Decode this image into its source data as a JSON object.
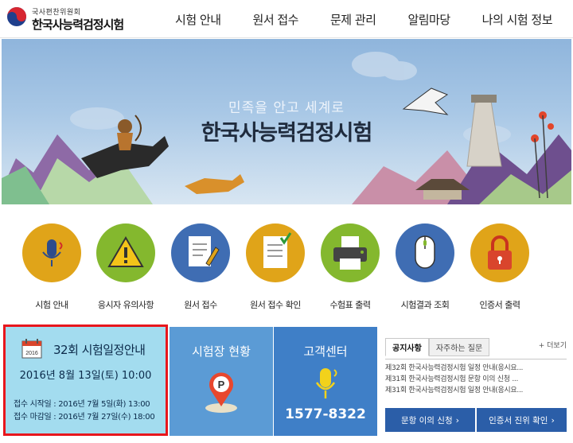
{
  "header": {
    "logo_sub": "국사편찬위원회",
    "logo_main": "한국사능력검정시험",
    "nav": [
      "시험 안내",
      "원서 접수",
      "문제 관리",
      "알림마당",
      "나의 시험 정보"
    ]
  },
  "banner": {
    "subtitle": "민족을 안고 세계로",
    "title": "한국사능력검정시험"
  },
  "quick_menu": [
    {
      "label": "시험 안내",
      "icon": "microphone-icon",
      "color": "#e0a419"
    },
    {
      "label": "응시자 유의사항",
      "icon": "warning-icon",
      "color": "#84b82e"
    },
    {
      "label": "원서 접수",
      "icon": "document-pen-icon",
      "color": "#3f6db3"
    },
    {
      "label": "원서 접수 확인",
      "icon": "checklist-icon",
      "color": "#e0a419"
    },
    {
      "label": "수험표 출력",
      "icon": "printer-icon",
      "color": "#84b82e"
    },
    {
      "label": "시험결과 조회",
      "icon": "mouse-icon",
      "color": "#3f6db3"
    },
    {
      "label": "인증서 출력",
      "icon": "lock-icon",
      "color": "#e0a419"
    }
  ],
  "schedule": {
    "calendar_year": "2016",
    "title": "32회 시험일정안내",
    "date": "2016년 8월 13일(토) 10:00",
    "start_line": "접수 시작일 : 2016년 7월   5일(화) 13:00",
    "end_line": "접수 마감일 : 2016년 7월 27일(수) 18:00"
  },
  "venue": {
    "title": "시험장 현황",
    "icon": "map-pin-icon"
  },
  "customer_center": {
    "title": "고객센터",
    "phone": "1577-8322",
    "icon": "microphone-icon"
  },
  "notice": {
    "tabs": [
      "공지사항",
      "자주하는 질문"
    ],
    "more": "+ 더보기",
    "items": [
      "제32회 한국사능력검정시험 일정 안내(응시요...",
      "제31회 한국사능력검정시험 문항 이의 신청 ...",
      "제31회 한국사능력검정시험 일정 안내(응시요..."
    ],
    "buttons": [
      "문항 이의 신청",
      "인증서 진위 확인"
    ]
  },
  "colors": {
    "accent_red": "#e8161c",
    "schedule_bg": "#a3dcef",
    "venue_bg": "#5b9bd5",
    "cs_bg": "#3f7fc7",
    "button_bg": "#2b5ea8"
  }
}
